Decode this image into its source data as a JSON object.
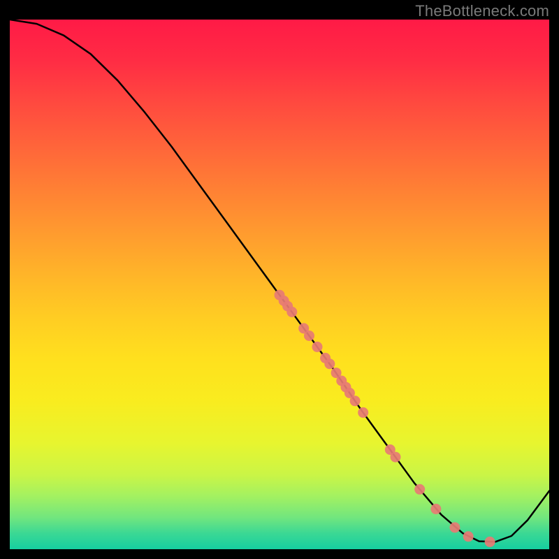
{
  "watermark": "TheBottleneck.com",
  "chart_data": {
    "type": "line",
    "title": "",
    "xlabel": "",
    "ylabel": "",
    "xlim": [
      0,
      100
    ],
    "ylim": [
      0,
      100
    ],
    "curve": [
      {
        "x": 0,
        "y": 100
      },
      {
        "x": 5,
        "y": 99.2
      },
      {
        "x": 10,
        "y": 97.0
      },
      {
        "x": 15,
        "y": 93.5
      },
      {
        "x": 20,
        "y": 88.5
      },
      {
        "x": 25,
        "y": 82.5
      },
      {
        "x": 30,
        "y": 76.0
      },
      {
        "x": 35,
        "y": 69.0
      },
      {
        "x": 40,
        "y": 62.0
      },
      {
        "x": 45,
        "y": 55.0
      },
      {
        "x": 50,
        "y": 48.0
      },
      {
        "x": 55,
        "y": 41.0
      },
      {
        "x": 60,
        "y": 34.0
      },
      {
        "x": 65,
        "y": 26.5
      },
      {
        "x": 70,
        "y": 19.5
      },
      {
        "x": 75,
        "y": 12.5
      },
      {
        "x": 80,
        "y": 6.5
      },
      {
        "x": 84,
        "y": 3.0
      },
      {
        "x": 87,
        "y": 1.5
      },
      {
        "x": 90,
        "y": 1.4
      },
      {
        "x": 93,
        "y": 2.5
      },
      {
        "x": 96,
        "y": 5.5
      },
      {
        "x": 100,
        "y": 11.0
      }
    ],
    "markers": [
      {
        "x": 50.0,
        "y": 48.0
      },
      {
        "x": 50.8,
        "y": 46.9
      },
      {
        "x": 51.5,
        "y": 45.9
      },
      {
        "x": 52.3,
        "y": 44.8
      },
      {
        "x": 54.5,
        "y": 41.7
      },
      {
        "x": 55.5,
        "y": 40.3
      },
      {
        "x": 57.0,
        "y": 38.2
      },
      {
        "x": 58.5,
        "y": 36.1
      },
      {
        "x": 59.3,
        "y": 35.0
      },
      {
        "x": 60.5,
        "y": 33.3
      },
      {
        "x": 61.5,
        "y": 31.8
      },
      {
        "x": 62.3,
        "y": 30.6
      },
      {
        "x": 63.0,
        "y": 29.5
      },
      {
        "x": 64.0,
        "y": 28.0
      },
      {
        "x": 65.5,
        "y": 25.8
      },
      {
        "x": 70.5,
        "y": 18.8
      },
      {
        "x": 71.5,
        "y": 17.4
      },
      {
        "x": 76.0,
        "y": 11.3
      },
      {
        "x": 79.0,
        "y": 7.6
      },
      {
        "x": 82.5,
        "y": 4.1
      },
      {
        "x": 85.0,
        "y": 2.4
      },
      {
        "x": 89.0,
        "y": 1.4
      }
    ]
  }
}
